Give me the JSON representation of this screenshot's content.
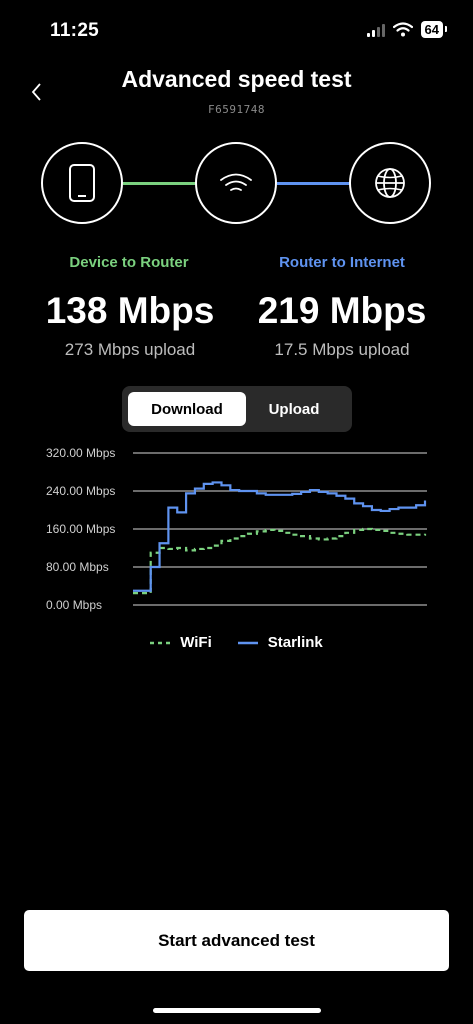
{
  "status_bar": {
    "time": "11:25",
    "battery": "64"
  },
  "header": {
    "title": "Advanced speed test",
    "device_id": "F6591748"
  },
  "nodes": [
    "phone-icon",
    "wifi-icon",
    "globe-icon"
  ],
  "colors": {
    "green": "#7bd17f",
    "blue": "#5f93f0"
  },
  "device_to_router": {
    "label": "Device to Router",
    "download": "138 Mbps",
    "upload": "273 Mbps upload"
  },
  "router_to_internet": {
    "label": "Router to Internet",
    "download": "219 Mbps",
    "upload": "17.5 Mbps upload"
  },
  "toggle": {
    "options": [
      "Download",
      "Upload"
    ],
    "selected": "Download"
  },
  "chart_data": {
    "type": "line",
    "y_tick_labels": [
      "320.00 Mbps",
      "240.00 Mbps",
      "160.00 Mbps",
      "80.00 Mbps",
      "0.00 Mbps"
    ],
    "ylim": [
      0,
      320
    ],
    "grid": true,
    "legend_position": "bottom",
    "series": [
      {
        "name": "WiFi",
        "style": "dashed",
        "color": "#7bd17f",
        "values": [
          25,
          25,
          110,
          120,
          118,
          120,
          115,
          118,
          120,
          125,
          135,
          140,
          145,
          150,
          155,
          158,
          156,
          152,
          148,
          145,
          140,
          138,
          140,
          145,
          152,
          158,
          160,
          158,
          156,
          152,
          150,
          148,
          148,
          150
        ]
      },
      {
        "name": "Starlink",
        "style": "solid",
        "color": "#5f93f0",
        "values": [
          30,
          30,
          80,
          130,
          205,
          195,
          235,
          245,
          255,
          258,
          252,
          242,
          240,
          240,
          235,
          232,
          232,
          232,
          234,
          238,
          242,
          238,
          235,
          230,
          224,
          214,
          208,
          200,
          198,
          202,
          205,
          205,
          210,
          220
        ]
      }
    ]
  },
  "legend": {
    "wifi": "WiFi",
    "starlink": "Starlink"
  },
  "start_button": "Start advanced test"
}
